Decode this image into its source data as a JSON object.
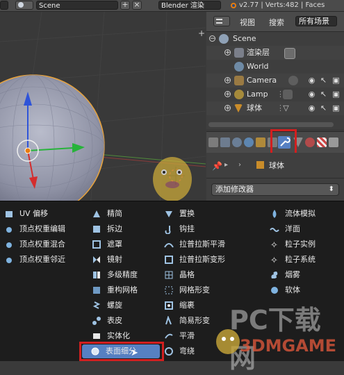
{
  "header": {
    "scene_name": "Scene",
    "render_engine": "Blender 渲染",
    "version_info": "v2.77 | Verts:482 | Faces"
  },
  "outliner": {
    "view_label": "视图",
    "search_label": "搜索",
    "filter_label": "所有场景",
    "items": [
      {
        "label": "Scene",
        "icon": "scene-icon"
      },
      {
        "label": "渲染层",
        "icon": "render-layers-icon"
      },
      {
        "label": "World",
        "icon": "world-icon"
      },
      {
        "label": "Camera",
        "icon": "camera-icon"
      },
      {
        "label": "Lamp",
        "icon": "lamp-icon"
      },
      {
        "label": "球体",
        "icon": "mesh-object-icon"
      }
    ]
  },
  "properties": {
    "active_tab": "modifiers-wrench-icon",
    "breadcrumb_object": "球体",
    "add_modifier_label": "添加修改器"
  },
  "modifier_menu": {
    "columns": [
      [
        {
          "label": "UV 偏移",
          "icon": "uv-project-icon"
        },
        {
          "label": "顶点权重编辑",
          "icon": "vertex-weight-icon"
        },
        {
          "label": "顶点权重混合",
          "icon": "vertex-weight-icon"
        },
        {
          "label": "顶点权重邻近",
          "icon": "vertex-weight-icon"
        }
      ],
      [
        {
          "label": "精简",
          "icon": "decimate-icon"
        },
        {
          "label": "拆边",
          "icon": "edge-split-icon"
        },
        {
          "label": "遮罩",
          "icon": "mask-icon"
        },
        {
          "label": "镜射",
          "icon": "mirror-icon"
        },
        {
          "label": "多级精度",
          "icon": "multires-icon"
        },
        {
          "label": "重构网格",
          "icon": "remesh-icon"
        },
        {
          "label": "螺旋",
          "icon": "screw-icon"
        },
        {
          "label": "表皮",
          "icon": "skin-icon"
        },
        {
          "label": "实体化",
          "icon": "solidify-icon"
        },
        {
          "label": "表面细分",
          "icon": "subsurf-icon"
        }
      ],
      [
        {
          "label": "置换",
          "icon": "displace-icon"
        },
        {
          "label": "钩挂",
          "icon": "hook-icon"
        },
        {
          "label": "拉普拉斯平滑",
          "icon": "laplacian-smooth-icon"
        },
        {
          "label": "拉普拉斯变形",
          "icon": "laplacian-deform-icon"
        },
        {
          "label": "晶格",
          "icon": "lattice-icon"
        },
        {
          "label": "网格形变",
          "icon": "mesh-deform-icon"
        },
        {
          "label": "缩裹",
          "icon": "shrinkwrap-icon"
        },
        {
          "label": "简易形变",
          "icon": "simple-deform-icon"
        },
        {
          "label": "平滑",
          "icon": "smooth-icon"
        },
        {
          "label": "弯绕",
          "icon": "warp-icon"
        }
      ],
      [
        {
          "label": "流体模拟",
          "icon": "fluid-icon"
        },
        {
          "label": "洋面",
          "icon": "ocean-icon"
        },
        {
          "label": "粒子实例",
          "icon": "particle-instance-icon"
        },
        {
          "label": "粒子系统",
          "icon": "particle-system-icon"
        },
        {
          "label": "烟雾",
          "icon": "smoke-icon"
        },
        {
          "label": "软体",
          "icon": "soft-body-icon"
        }
      ]
    ]
  },
  "watermark": {
    "line1": "PC下载网",
    "line2": "3DMGAME"
  },
  "colors": {
    "highlight_red": "#d21f1f",
    "selection_blue": "#5680c2",
    "menu_bg": "#1d1d1d",
    "object_outline": "#e8a33c"
  }
}
